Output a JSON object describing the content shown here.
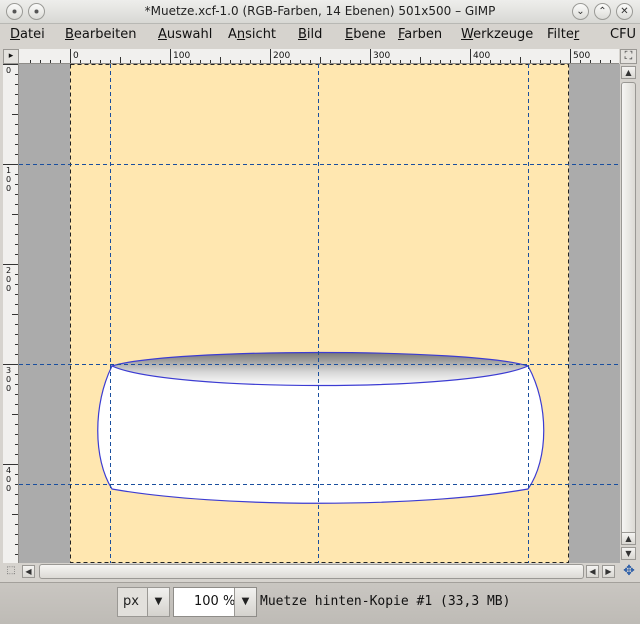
{
  "window": {
    "title": "*Muetze.xcf-1.0 (RGB-Farben, 14 Ebenen) 501x500 – GIMP",
    "menu_icon": "circle-dot-icon",
    "minimize_glyph": "⌄",
    "maximize_glyph": "⌃",
    "close_glyph": "✕"
  },
  "menubar": {
    "items": [
      {
        "label": "Datei",
        "mnemonic": "D"
      },
      {
        "label": "Bearbeiten",
        "mnemonic": "B"
      },
      {
        "label": "Auswahl",
        "mnemonic": "A"
      },
      {
        "label": "Ansicht",
        "mnemonic": "n"
      },
      {
        "label": "Bild",
        "mnemonic": "B"
      },
      {
        "label": "Ebene",
        "mnemonic": "E"
      },
      {
        "label": "Farben",
        "mnemonic": "F"
      },
      {
        "label": "Werkzeuge",
        "mnemonic": "W"
      },
      {
        "label": "Filter",
        "mnemonic": "r"
      },
      {
        "label": "CFU",
        "mnemonic": ""
      }
    ]
  },
  "rulers": {
    "horizontal_labels": [
      "0",
      "100",
      "200",
      "300",
      "400",
      "500"
    ],
    "vertical_labels": [
      "0",
      "100",
      "200",
      "300",
      "400"
    ]
  },
  "canvas": {
    "image_width": 501,
    "image_height": 500,
    "background_color": "#ffe7b0",
    "outside_color": "#ababab",
    "guide_color": "#1a4f9e",
    "outline_color": "#3c3cd2",
    "horizontal_guides": [
      100,
      300,
      420
    ],
    "vertical_guides": [
      40,
      248,
      458
    ]
  },
  "statusbar": {
    "unit": "px",
    "zoom": "100 %",
    "message": "Muetze hinten-Kopie #1 (33,3 MB)"
  },
  "icons": {
    "navigate": "navigate-icon",
    "quick_mask": "quick-mask-icon",
    "ruler_corner": "menu-arrow-icon"
  }
}
